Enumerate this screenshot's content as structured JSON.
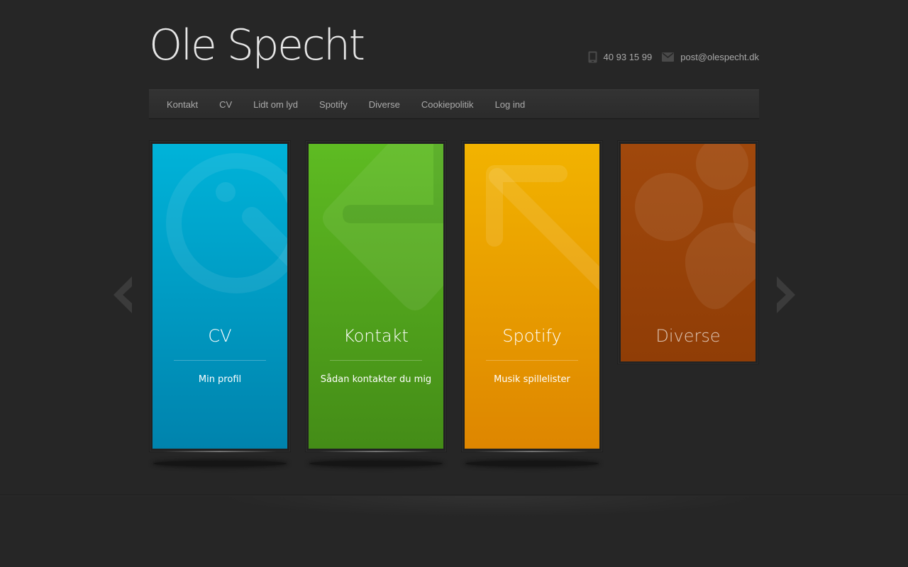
{
  "header": {
    "title": "Ole Specht",
    "phone": "40 93 15 99",
    "email": "post@olespecht.dk",
    "phone_icon": "phone-icon",
    "email_icon": "envelope-icon"
  },
  "nav": {
    "items": [
      "Kontakt",
      "CV",
      "Lidt om lyd",
      "Spotify",
      "Diverse",
      "Cookiepolitik",
      "Log ind"
    ]
  },
  "cards": [
    {
      "title": "CV",
      "subtitle": "Min profil",
      "color_top": "#00b3d9",
      "color_bottom": "#0083ad",
      "icon": "clock-icon"
    },
    {
      "title": "Kontakt",
      "subtitle": "Sådan kontakter du mig",
      "color_top": "#5ebb22",
      "color_bottom": "#448c17",
      "icon": "tag-icon"
    },
    {
      "title": "Spotify",
      "subtitle": "Musik spillelister",
      "color_top": "#f2b300",
      "color_bottom": "#de8600",
      "icon": "arrow-up-left-icon"
    },
    {
      "title": "Diverse",
      "subtitle": "",
      "color_top": "#a0480c",
      "color_bottom": "#903d06",
      "icon": "bubbles-icon"
    }
  ],
  "carousel": {
    "prev_icon": "chevron-left-icon",
    "next_icon": "chevron-right-icon"
  }
}
